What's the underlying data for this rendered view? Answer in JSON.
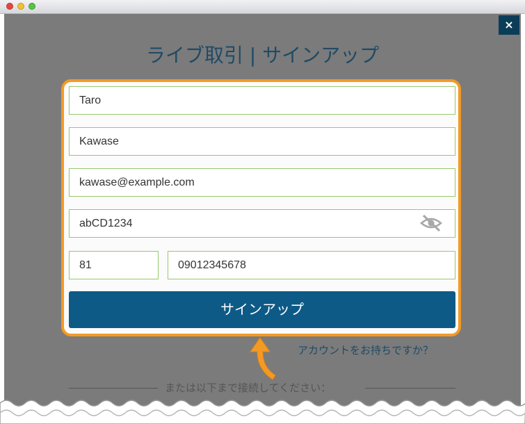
{
  "window": {
    "close_symbol": "×"
  },
  "modal": {
    "title": "ライブ取引 | サインアップ",
    "form": {
      "first_name": "Taro",
      "last_name": "Kawase",
      "email": "kawase@example.com",
      "password": "abCD1234",
      "country_code": "81",
      "phone": "09012345678",
      "submit_label": "サインアップ"
    },
    "login_link": "アカウントをお持ちですか？",
    "divider_text": "または以下まで接続してください："
  },
  "colors": {
    "overlay": "#7b7b7b",
    "primary_button": "#0e5a87",
    "highlight_border": "#f39a25",
    "field_border": "#94c96a",
    "close_button": "#0c3d58"
  },
  "icons": [
    "eye-slash-icon",
    "close-icon",
    "curved-arrow-icon"
  ]
}
